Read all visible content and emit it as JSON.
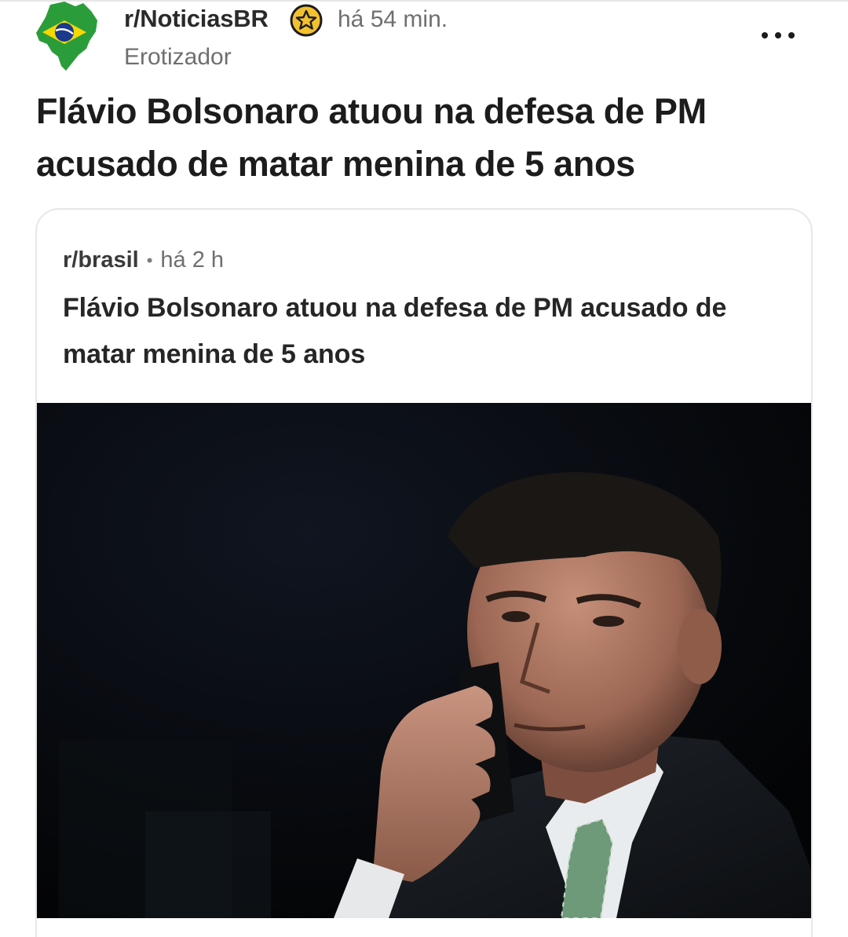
{
  "post": {
    "subreddit": "r/NoticiasBR",
    "time": "há 54 min.",
    "author": "Erotizador",
    "title": "Flávio Bolsonaro atuou na defesa de PM acusado de matar menina de 5 anos"
  },
  "icons": {
    "subreddit_icon": "brazil-map-flag-icon",
    "award_icon": "star-award-icon",
    "more_icon": "more-options-icon"
  },
  "crosspost": {
    "subreddit": "r/brasil",
    "separator": "•",
    "time": "há 2 h",
    "title": "Flávio Bolsonaro atuou na defesa de PM acusado de matar menina de 5 anos"
  },
  "colors": {
    "brazil_green": "#2a9d3a",
    "brazil_yellow": "#f5d800",
    "brazil_blue": "#1b3a8c",
    "award_gold": "#f2c12e",
    "muted_text": "#6f6f6f"
  }
}
